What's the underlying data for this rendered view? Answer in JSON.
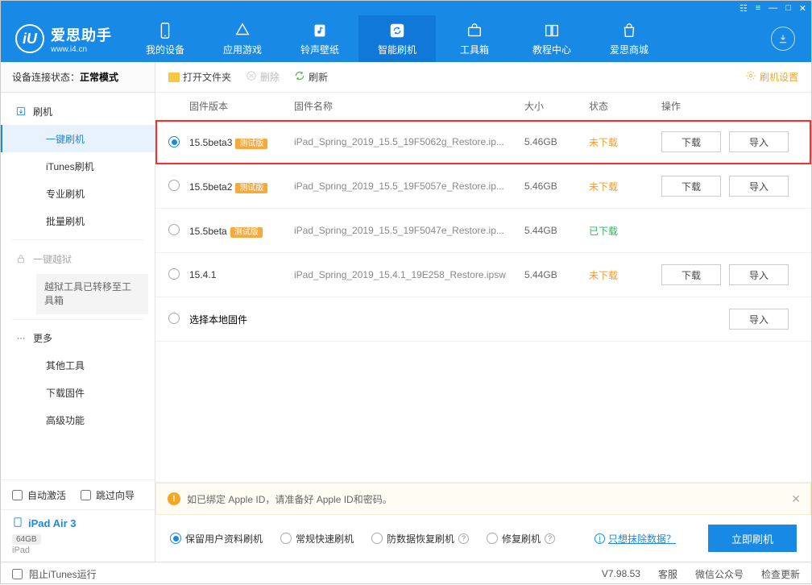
{
  "app": {
    "title": "爱思助手",
    "url": "www.i4.cn"
  },
  "titlebar": {
    "icons": [
      "☷",
      "≡",
      "—",
      "□",
      "✕"
    ]
  },
  "nav": [
    {
      "id": "device",
      "label": "我的设备"
    },
    {
      "id": "apps",
      "label": "应用游戏"
    },
    {
      "id": "ringtone",
      "label": "铃声壁纸"
    },
    {
      "id": "flash",
      "label": "智能刷机",
      "active": true
    },
    {
      "id": "toolbox",
      "label": "工具箱"
    },
    {
      "id": "tutorial",
      "label": "教程中心"
    },
    {
      "id": "store",
      "label": "爱思商城"
    }
  ],
  "sidebar": {
    "conn_label": "设备连接状态：",
    "conn_value": "正常模式",
    "items": {
      "flash": "刷机",
      "one_click": "一键刷机",
      "itunes": "iTunes刷机",
      "pro": "专业刷机",
      "batch": "批量刷机",
      "jailbreak": "一键越狱",
      "jailbreak_note": "越狱工具已转移至工具箱",
      "more": "更多",
      "other_tools": "其他工具",
      "download_fw": "下载固件",
      "advanced": "高级功能"
    },
    "auto_activate": "自动激活",
    "skip_guide": "跳过向导",
    "device": {
      "name": "iPad Air 3",
      "storage": "64GB",
      "type": "iPad"
    }
  },
  "toolbar": {
    "open_folder": "打开文件夹",
    "delete": "删除",
    "refresh": "刷新",
    "settings": "刷机设置"
  },
  "table": {
    "headers": {
      "version": "固件版本",
      "name": "固件名称",
      "size": "大小",
      "status": "状态",
      "action": "操作"
    },
    "beta_badge": "测试版",
    "btn_download": "下载",
    "btn_import": "导入",
    "local_firmware": "选择本地固件",
    "rows": [
      {
        "version": "15.5beta3",
        "beta": true,
        "name": "iPad_Spring_2019_15.5_19F5062g_Restore.ip...",
        "size": "5.46GB",
        "status": "未下载",
        "status_cls": "not",
        "selected": true,
        "highlight": true,
        "dl": true
      },
      {
        "version": "15.5beta2",
        "beta": true,
        "name": "iPad_Spring_2019_15.5_19F5057e_Restore.ip...",
        "size": "5.46GB",
        "status": "未下载",
        "status_cls": "not",
        "dl": true
      },
      {
        "version": "15.5beta",
        "beta": true,
        "name": "iPad_Spring_2019_15.5_19F5047e_Restore.ip...",
        "size": "5.44GB",
        "status": "已下载",
        "status_cls": "done"
      },
      {
        "version": "15.4.1",
        "beta": false,
        "name": "iPad_Spring_2019_15.4.1_19E258_Restore.ipsw",
        "size": "5.44GB",
        "status": "未下载",
        "status_cls": "not",
        "dl": true
      }
    ]
  },
  "notice": "如已绑定 Apple ID，请准备好 Apple ID和密码。",
  "options": {
    "keep_data": "保留用户资料刷机",
    "normal": "常规快速刷机",
    "anti_loss": "防数据恢复刷机",
    "repair": "修复刷机",
    "erase_link": "只想抹除数据？",
    "flash_btn": "立即刷机"
  },
  "footer": {
    "block_itunes": "阻止iTunes运行",
    "version": "V7.98.53",
    "support": "客服",
    "wechat": "微信公众号",
    "update": "检查更新"
  }
}
